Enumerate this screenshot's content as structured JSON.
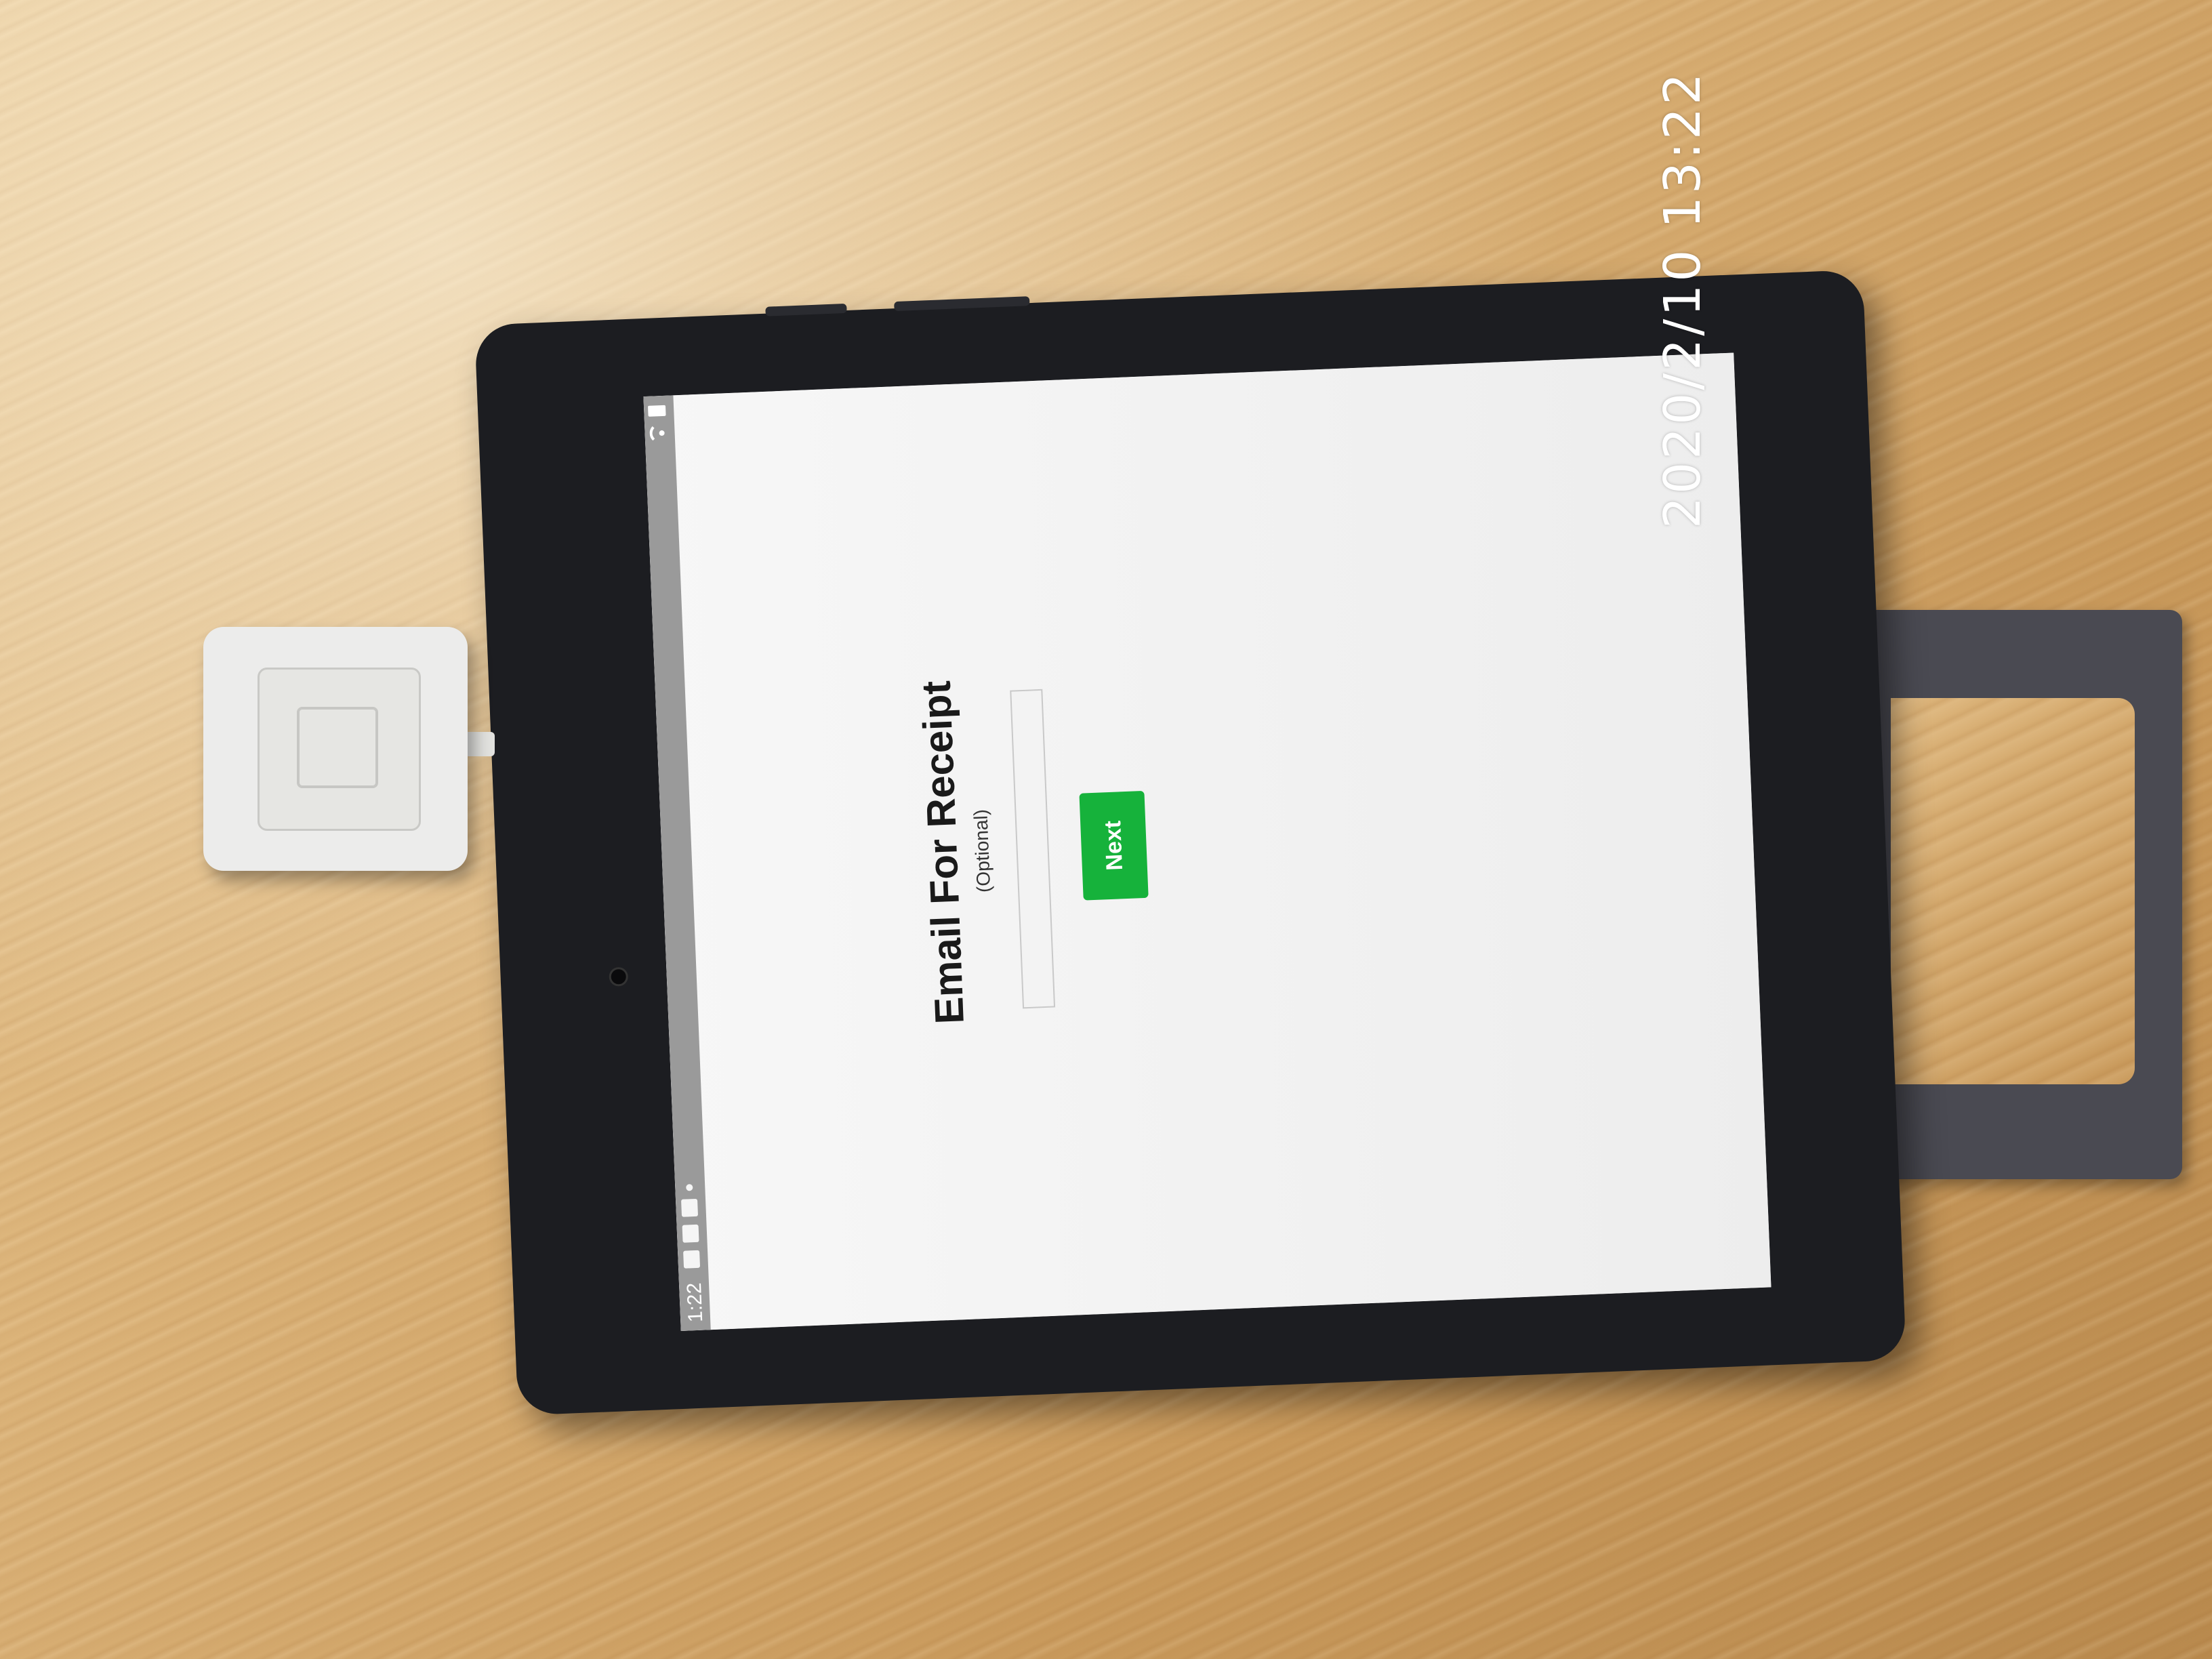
{
  "photo": {
    "timestamp": "2020/2/10  13:22"
  },
  "status_bar": {
    "time": "1:22",
    "left_icons": [
      "image-icon",
      "notification-icon",
      "app-icon",
      "overflow-dots-icon"
    ],
    "right_icons": [
      "wifi-icon",
      "battery-icon"
    ]
  },
  "receipt_form": {
    "title": "Email For Receipt",
    "subtitle": "(Optional)",
    "email_value": "",
    "next_label": "Next"
  },
  "colors": {
    "accent_button": "#16b23b",
    "status_bar": "#9a9a9a",
    "screen_background": "#f4f4f4"
  }
}
